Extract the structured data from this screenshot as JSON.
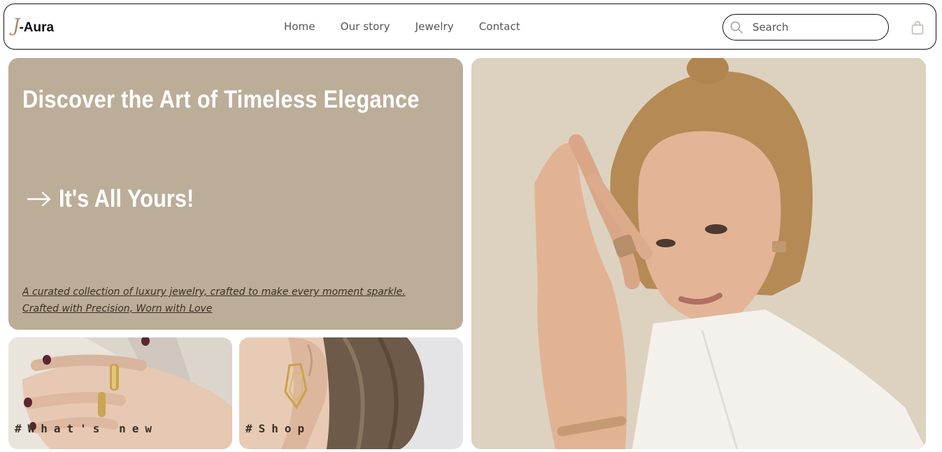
{
  "brand": {
    "mark": "J",
    "name": "-Aura"
  },
  "nav": {
    "items": [
      {
        "label": "Home"
      },
      {
        "label": "Our story"
      },
      {
        "label": "Jewelry"
      },
      {
        "label": "Contact"
      }
    ]
  },
  "search": {
    "placeholder": "Search",
    "value": ""
  },
  "icons": {
    "search": "search-icon",
    "cart": "shopping-bag-icon",
    "arrow": "arrow-right-icon"
  },
  "hero": {
    "title": "Discover the Art of Timeless Elegance",
    "cta": "It's All Yours!",
    "subtitle_line1": "A curated collection of luxury jewelry, crafted to make every moment sparkle.",
    "subtitle_line2": "Crafted with Precision, Worn with Love"
  },
  "tiles": [
    {
      "label": "#What's new"
    },
    {
      "label": "#Shop"
    }
  ],
  "colors": {
    "hero_bg": "#bcad98",
    "accent": "#a8876a",
    "text_dark": "#3a2f26"
  }
}
